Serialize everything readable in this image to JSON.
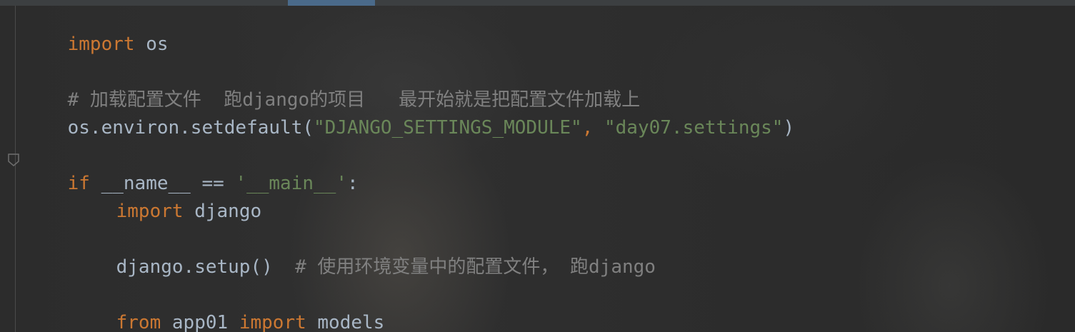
{
  "editor": {
    "line1": {
      "kw": "import",
      "rest": " os"
    },
    "line3": {
      "comment": "# 加载配置文件  跑django的项目   最开始就是把配置文件加载上"
    },
    "line4": {
      "call": "os.environ.setdefault(",
      "arg1": "\"DJANGO_SETTINGS_MODULE\"",
      "comma": ", ",
      "arg2": "\"day07.settings\"",
      "close": ")"
    },
    "line6": {
      "kw": "if",
      "mid": " __name__ == ",
      "str": "'__main__'",
      "colon": ":"
    },
    "line7": {
      "kw": "import",
      "rest": " django"
    },
    "line9": {
      "call": "django.setup()  ",
      "comment": "# 使用环境变量中的配置文件， 跑django"
    },
    "line11": {
      "kw1": "from",
      "mid": " app01 ",
      "kw2": "import",
      "rest": " models"
    }
  },
  "colors": {
    "keyword": "#cc7832",
    "string": "#6a8759",
    "comment": "#808080",
    "text": "#a9b7c6"
  },
  "icons": {
    "fold": "fold-marker-icon"
  }
}
